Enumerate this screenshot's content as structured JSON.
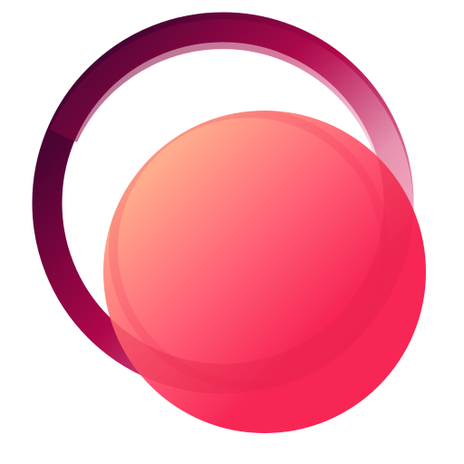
{
  "logo": {
    "name": "ring-and-sphere-logo",
    "colors": {
      "background": "#ffffff",
      "ring_dark": "#4a0333",
      "ring_mid": "#b0064a",
      "ring_light": "#f4a3bd",
      "sphere_highlight": "#ffb08e",
      "sphere_mid": "#ff5a74",
      "sphere_base": "#f72655",
      "overlap_shade": "#ee2a53"
    }
  }
}
